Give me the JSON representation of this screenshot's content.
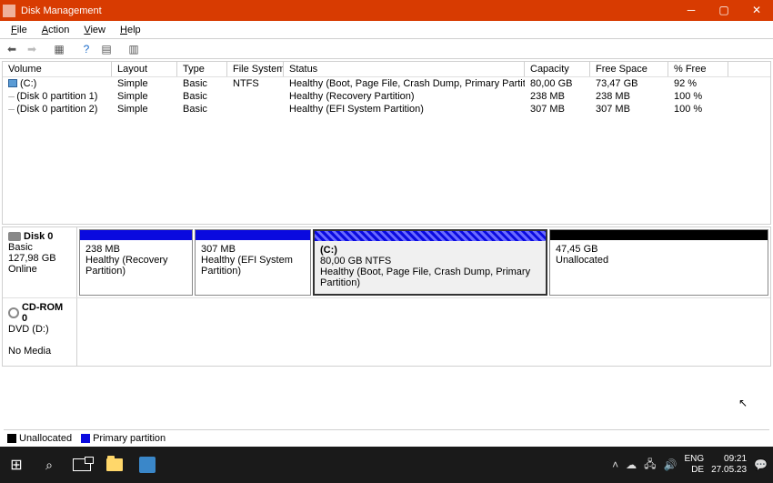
{
  "window": {
    "title": "Disk Management",
    "menu": [
      "File",
      "Action",
      "View",
      "Help"
    ]
  },
  "columns": {
    "volume": "Volume",
    "layout": "Layout",
    "type": "Type",
    "fs": "File System",
    "status": "Status",
    "capacity": "Capacity",
    "free": "Free Space",
    "pctfree": "% Free"
  },
  "volumes": [
    {
      "name": "(C:)",
      "layout": "Simple",
      "type": "Basic",
      "fs": "NTFS",
      "status": "Healthy (Boot, Page File, Crash Dump, Primary Partition)",
      "capacity": "80,00 GB",
      "free": "73,47 GB",
      "pct": "92 %"
    },
    {
      "name": "(Disk 0 partition 1)",
      "layout": "Simple",
      "type": "Basic",
      "fs": "",
      "status": "Healthy (Recovery Partition)",
      "capacity": "238 MB",
      "free": "238 MB",
      "pct": "100 %"
    },
    {
      "name": "(Disk 0 partition 2)",
      "layout": "Simple",
      "type": "Basic",
      "fs": "",
      "status": "Healthy (EFI System Partition)",
      "capacity": "307 MB",
      "free": "307 MB",
      "pct": "100 %"
    }
  ],
  "disk0": {
    "name": "Disk 0",
    "type": "Basic",
    "size": "127,98 GB",
    "state": "Online",
    "parts": [
      {
        "title": "",
        "line1": "238 MB",
        "line2": "Healthy (Recovery Partition)"
      },
      {
        "title": "",
        "line1": "307 MB",
        "line2": "Healthy (EFI System Partition)"
      },
      {
        "title": "(C:)",
        "line1": "80,00 GB NTFS",
        "line2": "Healthy (Boot, Page File, Crash Dump, Primary Partition)"
      },
      {
        "title": "",
        "line1": "47,45 GB",
        "line2": "Unallocated"
      }
    ]
  },
  "cdrom": {
    "name": "CD-ROM 0",
    "drive": "DVD (D:)",
    "state": "No Media"
  },
  "legend": {
    "unallocated": "Unallocated",
    "primary": "Primary partition"
  },
  "tray": {
    "lang1": "ENG",
    "lang2": "DE",
    "time": "09:21",
    "date": "27.05.23"
  }
}
